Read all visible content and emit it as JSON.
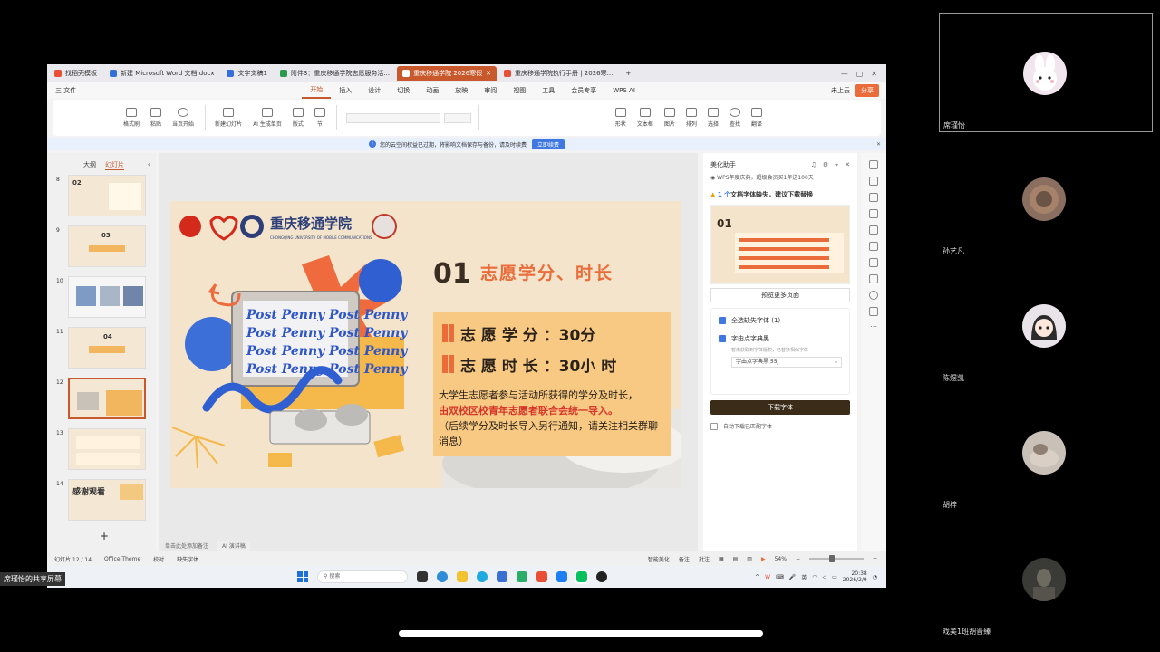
{
  "screen": {
    "tabs": [
      {
        "label": "找稻壳模板",
        "color": "#e94f35",
        "active": false
      },
      {
        "label": "新建 Microsoft Word 文档.docx",
        "color": "#3570d8",
        "active": false
      },
      {
        "label": "文字文稿1",
        "color": "#3570d8",
        "active": false
      },
      {
        "label": "附件3：重庆移通学院志愿服务活...",
        "color": "#2b9a4d",
        "active": false
      },
      {
        "label": "重庆移通学院 2026寒假",
        "color": "#e96c3a",
        "active": true
      },
      {
        "label": "重庆移通学院执行手册 | 2026寒...",
        "color": "#e94f35",
        "active": false
      }
    ],
    "menu": {
      "file": "三 文件",
      "items": [
        "开始",
        "插入",
        "设计",
        "切换",
        "动画",
        "放映",
        "审阅",
        "视图",
        "工具",
        "会员专享",
        "WPS AI"
      ],
      "active_index": 0,
      "cloud": "未上云",
      "share": "分享"
    },
    "ribbon": {
      "buttons": [
        "格式刷",
        "粘贴",
        "当页开始",
        "新建幻灯片",
        "AI 生成单页",
        "版式",
        "节"
      ],
      "right_buttons": [
        "形状",
        "图片",
        "选择",
        "文本框",
        "排列",
        "查找",
        "翻译"
      ]
    },
    "infobar": {
      "text": "您的云空间权益已过期，将影响文档保存与备份，请及时续费",
      "button": "立即续费"
    },
    "thumbs": {
      "tabs": [
        "大纲",
        "幻灯片"
      ],
      "items": [
        {
          "num": "8",
          "title": "02"
        },
        {
          "num": "9",
          "title": "03"
        },
        {
          "num": "10",
          "title": ""
        },
        {
          "num": "11",
          "title": "04"
        },
        {
          "num": "12",
          "title": ""
        },
        {
          "num": "13",
          "title": ""
        },
        {
          "num": "14",
          "title": "感谢观看"
        }
      ],
      "selected_index": 4,
      "add": "+"
    },
    "slide": {
      "school": "重庆移通学院",
      "school_en": "CHONGQING UNIVERSITY OF MOBILE COMMUNICATIONS",
      "section_num": "01",
      "section_title": "志愿学分、时长",
      "credit": "志 愿 学 分 ：30分",
      "hours": "志 愿 时 长 ：30小 时",
      "desc1": "大学生志愿者参与活动所获得的学分及时长，",
      "desc2": "由双校区校青年志愿者联合会统一导入。",
      "desc3": "（后续学分及时长导入另行通知，请关注相关群聊消息）",
      "screen_text": "Post Penny Post Penny"
    },
    "notes": {
      "placeholder": "单击此处添加备注",
      "ai": "AI 演讲稿"
    },
    "side": {
      "title": "美化助手",
      "promo": "WPS年度庆典，超级会员买1年送100天",
      "warn_prefix": "1 个",
      "warn": "文档字体缺失，建议下载替换",
      "preview_more": "预览更多页面",
      "select_all": "全选缺失字体 (1)",
      "font_name": "字由点字典黑",
      "font_hint": "暂未获取到字体版权，已替换相似字体",
      "font_option": "字由点字典黑 55J",
      "download": "下载字体",
      "auto": "自动下载已匹配字体"
    },
    "status": {
      "slide_count": "幻灯片 12 / 14",
      "theme": "Office Theme",
      "proof": "校对",
      "missing_font": "缺失字体",
      "beautify": "智能美化",
      "notes_btn": "备注",
      "comment": "批注",
      "zoom": "54%"
    },
    "taskbar": {
      "search": "搜索",
      "ime": "英",
      "time": "20:38",
      "date": "2026/2/9"
    },
    "share_label": "席瑾怡的共享屏幕"
  },
  "participants": [
    {
      "name": "席瑾怡",
      "avatar_color": "#f1e6ee",
      "active": true
    },
    {
      "name": "孙艺凡",
      "avatar_color": "#8a6f60",
      "active": false
    },
    {
      "name": "陈煜凯",
      "avatar_color": "#e8e4ea",
      "active": false
    },
    {
      "name": "胡梓",
      "avatar_color": "#c9c0b8",
      "active": false
    },
    {
      "name": "戏美1班胡晋臻",
      "avatar_color": "#3a3a36",
      "active": false
    }
  ]
}
